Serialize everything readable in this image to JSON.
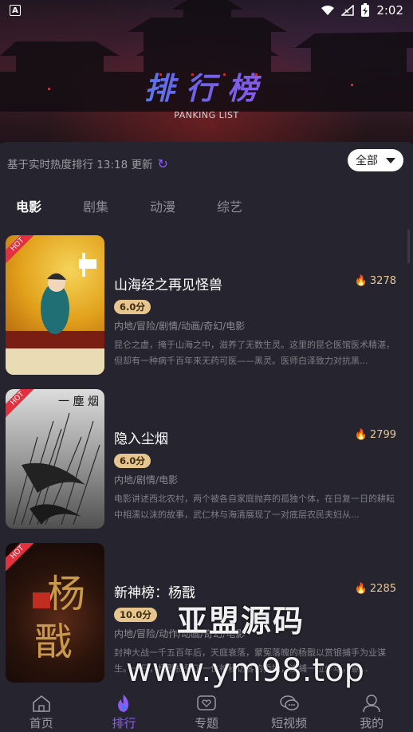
{
  "status_bar": {
    "time": "2:02",
    "left_badge": "A"
  },
  "banner": {
    "title": "排行榜",
    "subtitle": "PANKING LIST"
  },
  "info_line": "基于实时热度排行 13:18 更新",
  "filter": {
    "selected": "全部"
  },
  "tabs": [
    {
      "label": "电影",
      "active": true
    },
    {
      "label": "剧集",
      "active": false
    },
    {
      "label": "动漫",
      "active": false
    },
    {
      "label": "综艺",
      "active": false
    }
  ],
  "hot_label": "HOT",
  "items": [
    {
      "title": "山海经之再见怪兽",
      "heat": "3278",
      "score": "6.0分",
      "genres": "内地/冒险/剧情/动画/奇幻/电影",
      "desc": "昆仑之虚，掩于山海之中，滋养了无数生灵。这里的昆仑医馆医术精湛，但却有一种病千百年来无药可医——黑灵。医师白泽致力对抗黑..."
    },
    {
      "title": "隐入尘烟",
      "heat": "2799",
      "score": "6.0分",
      "genres": "内地/剧情/电影",
      "desc": "电影讲述西北农村，两个被各自家庭抛弃的孤独个体，在日复一日的耕耘中相濡以沫的故事，武仁林与海清展现了一对底层农民夫妇从..."
    },
    {
      "title": "新神榜：杨戬",
      "heat": "2285",
      "score": "10.0分",
      "genres": "内地/冒险/动作/动画/奇幻/电影",
      "desc": "封神大战一千五百年后，天庭衰落，蒙冤落魄的杨戬以赏银捕手为业谋生。一日，杨戬接受了一位神秘访客的委托，追捕一位少年，意..."
    }
  ],
  "watermark": {
    "line1": "亚盟源码",
    "line2": "www.ym98.top"
  },
  "nav": [
    {
      "label": "首页",
      "icon": "home-icon",
      "active": false
    },
    {
      "label": "排行",
      "icon": "flame-icon",
      "active": true
    },
    {
      "label": "专题",
      "icon": "heart-icon",
      "active": false
    },
    {
      "label": "短视频",
      "icon": "chat-bubbles-icon",
      "active": false
    },
    {
      "label": "我的",
      "icon": "user-icon",
      "active": false
    }
  ],
  "colors": {
    "accent": "#8e5cf3",
    "hot": "#e2303e",
    "score_badge": "#e6c58e",
    "background": "#26252f"
  }
}
